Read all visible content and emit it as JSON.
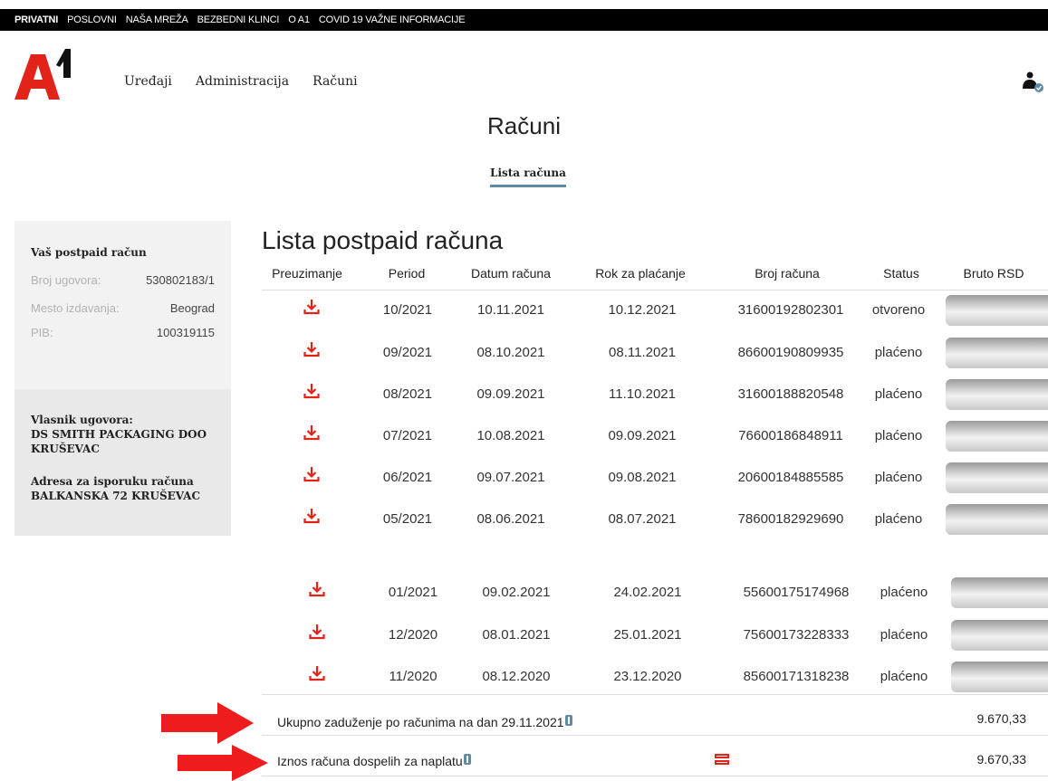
{
  "topnav": {
    "items": [
      "PRIVATNI",
      "POSLOVNI",
      "NAŠA MREŽA",
      "BEZBEDNI KLINCI",
      "O A1",
      "COVID 19 VAŽNE INFORMACIJE"
    ]
  },
  "header": {
    "logo_icon": "a1-logo-icon",
    "nav": [
      "Uređaji",
      "Administracija",
      "Računi"
    ],
    "user_icon": "user-icon"
  },
  "page": {
    "title": "Računi",
    "subtab": "Lista računa"
  },
  "sidebar": {
    "title": "Vaš postpaid račun",
    "rows": [
      {
        "label": "Broj ugovora:",
        "value": "530802183/1"
      },
      {
        "label": "Mesto izdavanja:",
        "value": "Beograd"
      },
      {
        "label": "PIB:",
        "value": "100319115"
      }
    ],
    "owner_label": "Vlasnik ugovora:",
    "owner_name": "DS SMITH PACKAGING DOO KRUŠEVAC",
    "address_label": "Adresa za isporuku računa",
    "address_value": "BALKANSKA 72 KRUŠEVAC"
  },
  "list": {
    "title": "Lista postpaid računa",
    "headers": [
      "Preuzimanje",
      "Period",
      "Datum računa",
      "Rok za plaćanje",
      "Broj računa",
      "Status",
      "Bruto RSD"
    ],
    "rows": [
      {
        "period": "10/2021",
        "date": "10.11.2021",
        "due": "10.12.2021",
        "number": "31600192802301",
        "status": "otvoreno"
      },
      {
        "period": "09/2021",
        "date": "08.10.2021",
        "due": "08.11.2021",
        "number": "86600190809935",
        "status": "plaćeno"
      },
      {
        "period": "08/2021",
        "date": "09.09.2021",
        "due": "11.10.2021",
        "number": "31600188820548",
        "status": "plaćeno"
      },
      {
        "period": "07/2021",
        "date": "10.08.2021",
        "due": "09.09.2021",
        "number": "76600186848911",
        "status": "plaćeno"
      },
      {
        "period": "06/2021",
        "date": "09.07.2021",
        "due": "09.08.2021",
        "number": "20600184885585",
        "status": "plaćeno"
      },
      {
        "period": "05/2021",
        "date": "08.06.2021",
        "due": "08.07.2021",
        "number": "78600182929690",
        "status": "plaćeno"
      },
      {
        "period": "01/2021",
        "date": "09.02.2021",
        "due": "24.02.2021",
        "number": "55600175174968",
        "status": "plaćeno"
      },
      {
        "period": "12/2020",
        "date": "08.01.2021",
        "due": "25.01.2021",
        "number": "75600173228333",
        "status": "plaćeno"
      },
      {
        "period": "11/2020",
        "date": "08.12.2020",
        "due": "23.12.2020",
        "number": "85600171318238",
        "status": "plaćeno"
      }
    ]
  },
  "summary": {
    "total_label": "Ukupno zaduženje po računima na dan 29.11.2021",
    "total_value": "9.670,33",
    "due_label": "Iznos računa dospelih za naplatu",
    "due_value": "9.670,33"
  },
  "colors": {
    "accent_red": "#e2231a",
    "accent_blue": "#5f8aa6",
    "arrow_red": "#ee1c1c"
  }
}
